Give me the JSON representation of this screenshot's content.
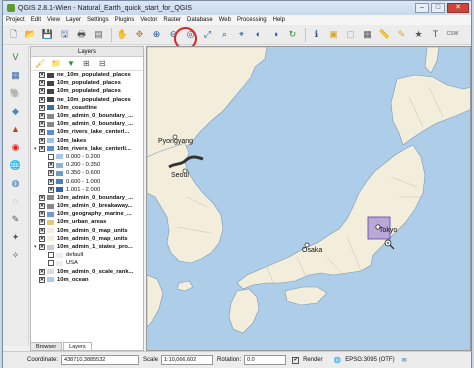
{
  "window": {
    "title": "QGIS 2.8.1-Wien - Natural_Earth_quick_start_for_QGIS"
  },
  "menu": [
    "Project",
    "Edit",
    "View",
    "Layer",
    "Settings",
    "Plugins",
    "Vector",
    "Raster",
    "Database",
    "Web",
    "Processing",
    "Help"
  ],
  "layers_panel": {
    "title": "Layers",
    "items": [
      {
        "label": "ne_10m_populated_places",
        "checked": true,
        "sym": "#444",
        "exp": ""
      },
      {
        "label": "10m_populated_places",
        "checked": true,
        "sym": "#444",
        "exp": ""
      },
      {
        "label": "10m_populated_places",
        "checked": true,
        "sym": "#444",
        "exp": ""
      },
      {
        "label": "ne_10m_populated_places",
        "checked": true,
        "sym": "#444",
        "exp": ""
      },
      {
        "label": "10m_coastline",
        "checked": true,
        "sym": "#3b6fa0",
        "exp": ""
      },
      {
        "label": "10m_admin_0_boundary_...",
        "checked": true,
        "sym": "#888",
        "exp": ""
      },
      {
        "label": "10m_admin_0_boundary_...",
        "checked": true,
        "sym": "#888",
        "exp": ""
      },
      {
        "label": "10m_rivers_lake_centerl...",
        "checked": true,
        "sym": "#5b8fd0",
        "exp": ""
      },
      {
        "label": "10m_lakes",
        "checked": true,
        "sym": "#9fc2e6",
        "exp": ""
      },
      {
        "label": "10m_rivers_lake_centerli...",
        "checked": true,
        "sym": "#5b8fd0",
        "exp": "▾"
      },
      {
        "label": "0.000 - 0.200",
        "checked": false,
        "sym": "#aac6e8",
        "sub": true
      },
      {
        "label": "0.200 - 0.350",
        "checked": true,
        "sym": "#8bb3e0",
        "sub": true
      },
      {
        "label": "0.350 - 0.600",
        "checked": true,
        "sym": "#6b9bd3",
        "sub": true
      },
      {
        "label": "0.600 - 1.000",
        "checked": true,
        "sym": "#4a80c4",
        "sub": true
      },
      {
        "label": "1.001 - 2.000",
        "checked": true,
        "sym": "#2a63ae",
        "sub": true
      },
      {
        "label": "10m_admin_0_boundary_...",
        "checked": true,
        "sym": "#888",
        "exp": ""
      },
      {
        "label": "10m_admin_0_breakaway...",
        "checked": true,
        "sym": "#888",
        "exp": ""
      },
      {
        "label": "10m_geography_marine_...",
        "checked": true,
        "sym": "#6b9bd3",
        "exp": ""
      },
      {
        "label": "10m_urban_areas",
        "checked": true,
        "sym": "#e8c57a",
        "exp": ""
      },
      {
        "label": "10m_admin_0_map_units",
        "checked": true,
        "sym": "#f3eedc",
        "exp": ""
      },
      {
        "label": "10m_admin_0_map_units",
        "checked": true,
        "sym": "#f3eedc",
        "exp": ""
      },
      {
        "label": "10m_admin_1_states_pro...",
        "checked": true,
        "sym": "#ccc",
        "exp": "▾"
      },
      {
        "label": "default",
        "checked": false,
        "sym": "#eee",
        "sub": true
      },
      {
        "label": "USA",
        "checked": false,
        "sym": "#eee",
        "sub": true
      },
      {
        "label": "10m_admin_0_scale_rank...",
        "checked": true,
        "sym": "#ddd",
        "exp": ""
      },
      {
        "label": "10m_ocean",
        "checked": true,
        "sym": "#aecde8",
        "exp": ""
      }
    ]
  },
  "tabs": [
    "Browser",
    "Layers"
  ],
  "map_labels": {
    "pyongyang": "Pyongyang",
    "seoul": "Seoul",
    "osaka": "Osaka",
    "tokyo": "Tokyo"
  },
  "status": {
    "coord_label": "Coordinate:",
    "coord_value": "438710,3885532",
    "scale_label": "Scale",
    "scale_value": "1:10,066,602",
    "rotation_label": "Rotation:",
    "rotation_value": "0.0",
    "render_label": "Render",
    "crs_value": "EPSG:3095 (OTF)"
  }
}
